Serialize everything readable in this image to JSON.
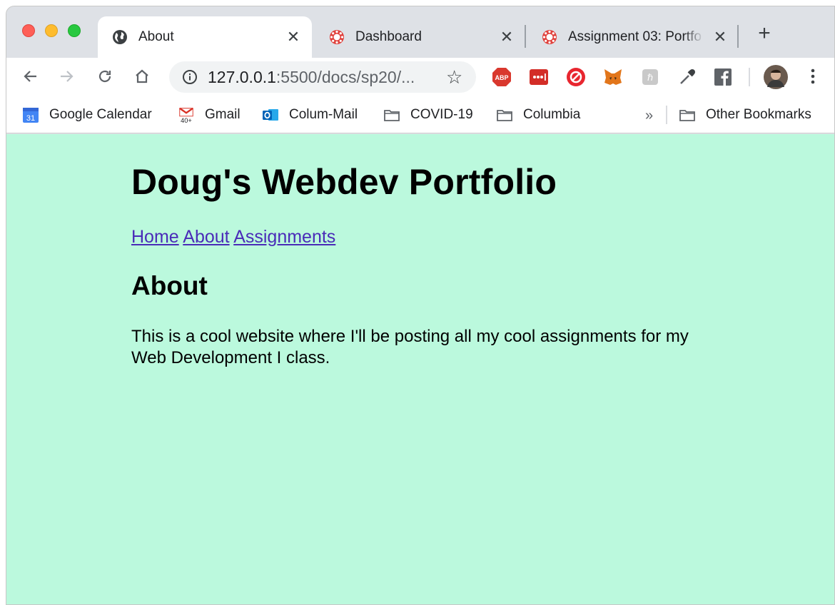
{
  "browser": {
    "tabs": [
      {
        "title": "About",
        "icon": "globe-icon",
        "active": true
      },
      {
        "title": "Dashboard",
        "icon": "canvas-icon",
        "active": false
      },
      {
        "title": "Assignment 03: Portfo",
        "icon": "canvas-icon",
        "active": false
      }
    ],
    "close_glyph": "✕",
    "new_tab_glyph": "+",
    "address_bar": {
      "host": "127.0.0.1",
      "rest": ":5500/docs/sp20/..."
    },
    "extensions": [
      "adblock-icon",
      "lastpass-icon",
      "creative-cloud-icon",
      "metamask-icon",
      "extension-icon",
      "eyedropper-icon",
      "facebook-icon"
    ],
    "bookmarks": [
      {
        "label": "Google Calendar",
        "icon": "google-calendar-icon",
        "badge": "31"
      },
      {
        "label": "Gmail",
        "icon": "gmail-icon",
        "badge": "40+"
      },
      {
        "label": "Colum-Mail",
        "icon": "outlook-icon"
      },
      {
        "label": "COVID-19",
        "icon": "folder-icon"
      },
      {
        "label": "Columbia",
        "icon": "folder-icon"
      }
    ],
    "bookmarks_overflow": "»",
    "other_bookmarks": "Other Bookmarks"
  },
  "page": {
    "background": "#bbf9dd",
    "heading": "Doug's Webdev Portfolio",
    "nav": [
      {
        "label": "Home"
      },
      {
        "label": "About"
      },
      {
        "label": "Assignments"
      }
    ],
    "section_heading": "About",
    "paragraph": "This is a cool website where I'll be posting all my cool assignments for my Web Development I class."
  },
  "colors": {
    "link": "#4a2bb8",
    "tabstrip": "#dee1e6"
  }
}
